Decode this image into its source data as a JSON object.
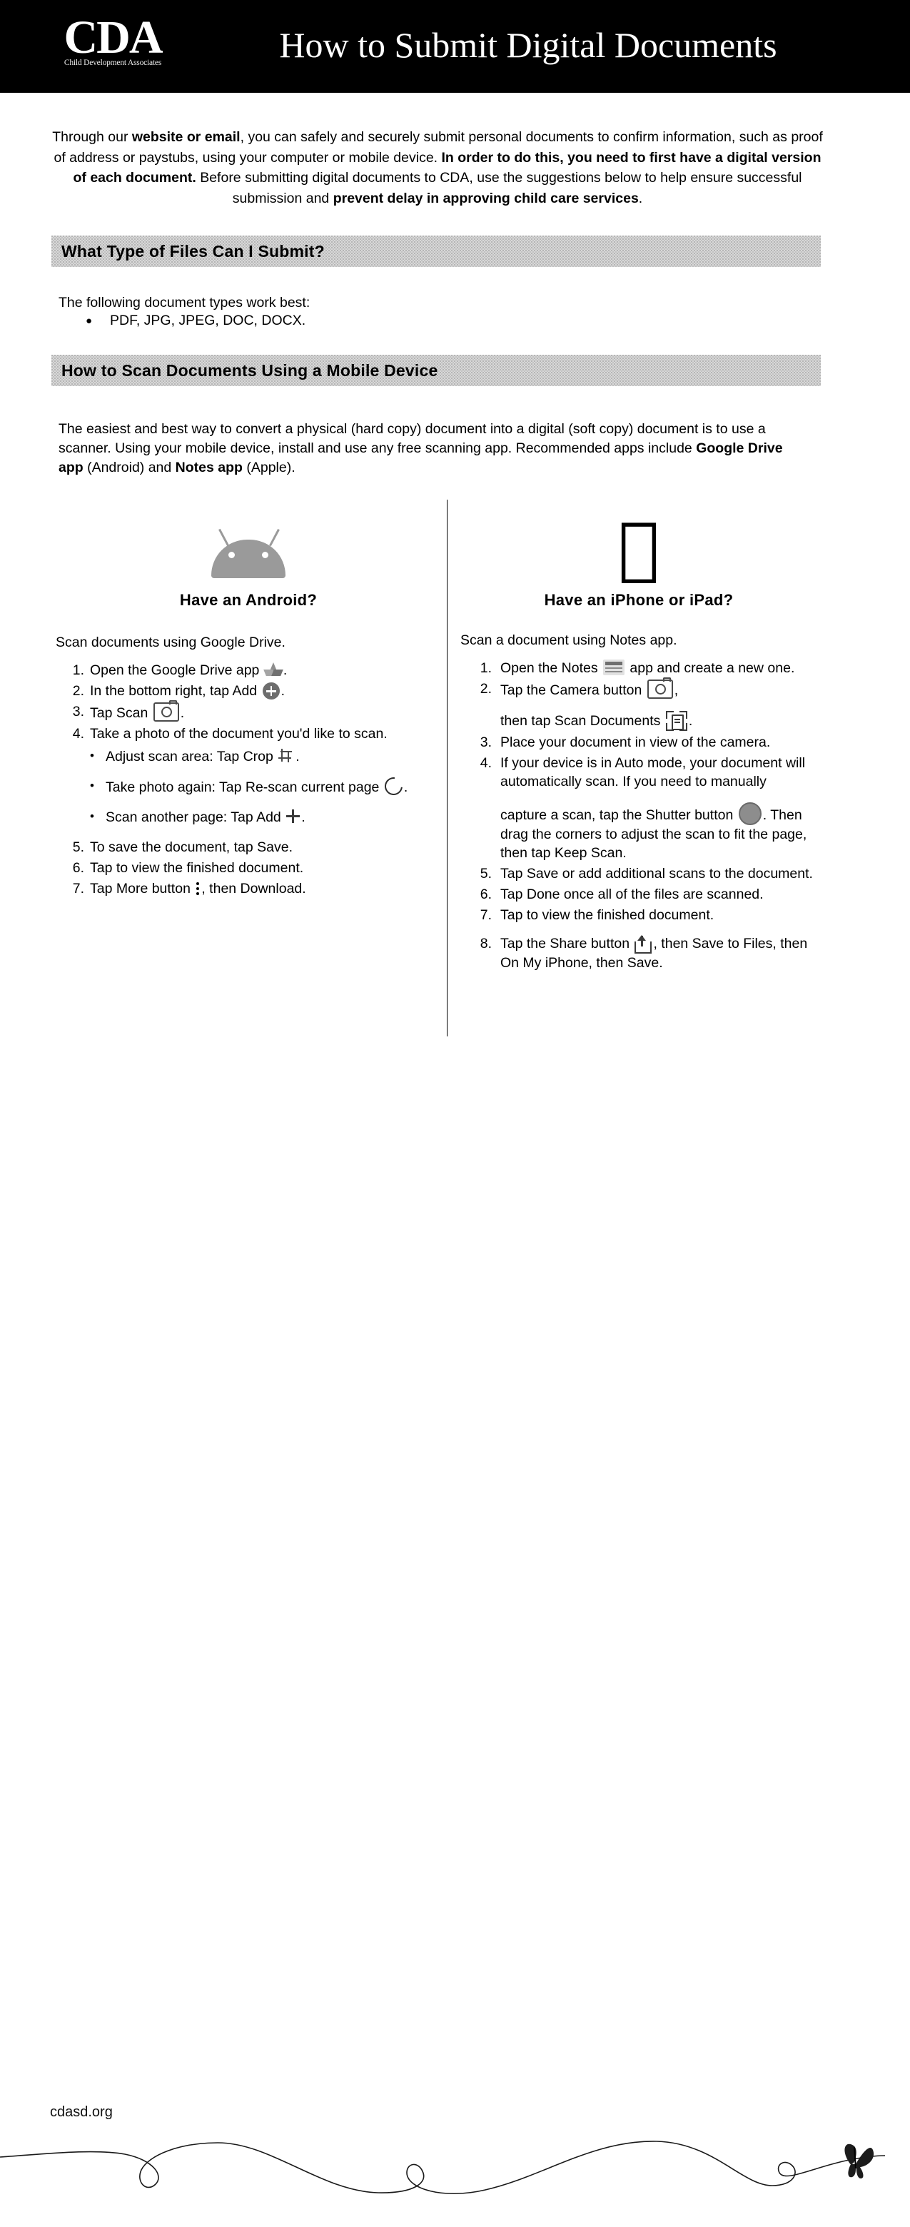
{
  "header": {
    "logo_main": "CDA",
    "logo_sub": "Child Development Associates",
    "title": "How to Submit Digital Documents"
  },
  "intro": {
    "line1_a": "Through our ",
    "line1_b": "website or email",
    "line1_c": ", you can safely and securely submit personal documents to confirm information, such as proof of address or paystubs, using your computer or mobile device. ",
    "line2_b": "In order to do this, you need to first have a digital version of each document.",
    "line2_c": " Before submitting digital documents to CDA, use the suggestions below to help ensure successful submission and ",
    "line3_b": "prevent delay in approving child care services",
    "line3_c": "."
  },
  "files_section": {
    "banner": "What Type of Files Can I Submit?",
    "lead": "The following document types work best:",
    "bullet_char": "●",
    "bullets": [
      "PDF, JPG, JPEG, DOC, DOCX."
    ]
  },
  "scan_section": {
    "banner": "How to Scan Documents Using a Mobile Device",
    "paragraph_a": "The easiest and best way to convert a physical (hard copy) document into a digital (soft copy) document is to use a scanner. Using your mobile device, install and use any free scanning app. Recommended apps include ",
    "paragraph_b": "Google Drive app",
    "paragraph_c": " (Android) and ",
    "paragraph_d": "Notes app",
    "paragraph_e": " (Apple)."
  },
  "android": {
    "icon": "android-robot-icon",
    "title": "Have an Android?",
    "lead": "Scan documents using Google Drive.",
    "steps": [
      {
        "num": "1.",
        "text_before": "Open the Google Drive app ",
        "icon": "google-drive-icon",
        "text_after": "."
      },
      {
        "num": "2.",
        "text_before": "In the bottom right, tap Add ",
        "icon": "add-circle-icon",
        "text_after": "."
      },
      {
        "num": "3.",
        "text_before": "Tap Scan ",
        "icon": "camera-icon",
        "text_after": "."
      },
      {
        "num": "4.",
        "text_before": "Take a photo of the document you'd like to scan.",
        "icon": "",
        "text_after": ""
      },
      {
        "num": "5.",
        "text_before": "To save the document, tap Save.",
        "icon": "",
        "text_after": ""
      },
      {
        "num": "6.",
        "text_before": "Tap to view the finished document.",
        "icon": "",
        "text_after": ""
      },
      {
        "num": "7.",
        "text_before": "Tap More button ",
        "icon": "more-vertical-icon",
        "text_after": ", then Download."
      }
    ],
    "substeps": [
      {
        "bullet": "•",
        "text_before": "Adjust scan area: Tap Crop ",
        "icon": "crop-icon",
        "text_after": "."
      },
      {
        "bullet": "•",
        "text_before": "Take photo again: Tap Re-scan current page ",
        "icon": "rescan-icon",
        "text_after": "."
      },
      {
        "bullet": "•",
        "text_before": "Scan another page: Tap Add ",
        "icon": "plus-icon",
        "text_after": "."
      }
    ]
  },
  "apple": {
    "icon": "apple-logo-icon",
    "title": "Have an iPhone or iPad?",
    "lead": "Scan a document using Notes app.",
    "steps": [
      {
        "num": "1.",
        "text_before": "Open the Notes ",
        "icon": "notes-app-icon",
        "text_after": " app and create a new one."
      },
      {
        "num": "2.",
        "text_before": "Tap the Camera button ",
        "icon": "camera-icon",
        "text_after": ",",
        "cont_before": "then tap Scan Documents ",
        "cont_icon": "scan-documents-icon",
        "cont_after": "."
      },
      {
        "num": "3.",
        "text_before": "Place your document in view of the camera.",
        "icon": "",
        "text_after": ""
      },
      {
        "num": "4.",
        "text_before": "If your device is in Auto mode, your document will automatically scan. If you need to manually",
        "icon": "",
        "text_after": "",
        "cont_before": "capture a scan, tap the Shutter button ",
        "cont_icon": "shutter-icon",
        "cont_after": ". Then drag the corners to adjust the scan to fit the page, then tap Keep Scan."
      },
      {
        "num": "5.",
        "text_before": "Tap Save or add additional scans to the document.",
        "icon": "",
        "text_after": ""
      },
      {
        "num": "6.",
        "text_before": "Tap Done once all of the files are scanned.",
        "icon": "",
        "text_after": ""
      },
      {
        "num": "7.",
        "text_before": "Tap to view the finished document.",
        "icon": "",
        "text_after": ""
      },
      {
        "num": "8.",
        "text_before": "Tap the Share button ",
        "icon": "share-icon",
        "text_after": ", then Save to Files, then On My iPhone, then Save."
      }
    ]
  },
  "footer": {
    "url": "cdasd.org",
    "decoration": "swirl-line-with-butterfly"
  },
  "colors": {
    "header_bg": "#000000",
    "banner_bg": "#d8d8d8",
    "text": "#000000",
    "android_gray": "#9a9a9a"
  }
}
